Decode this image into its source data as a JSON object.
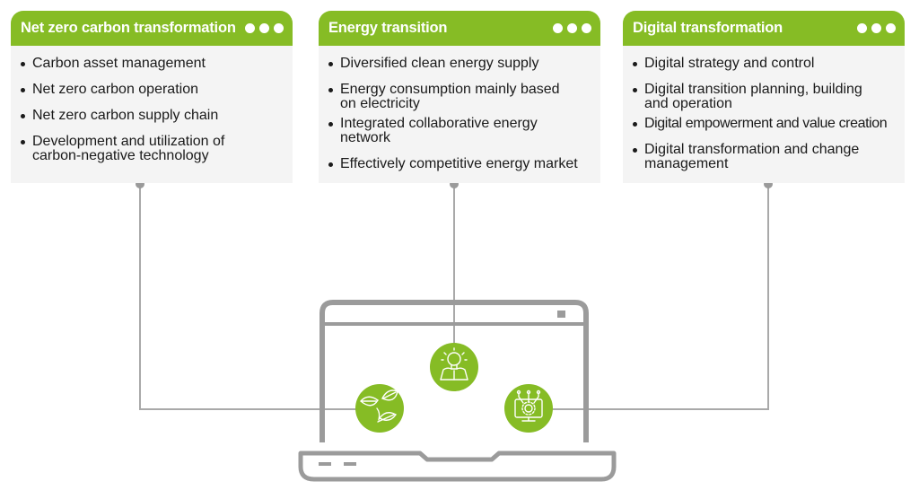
{
  "cards": [
    {
      "title": "Net zero carbon transformation",
      "items": [
        "Carbon asset management",
        "Net zero carbon operation",
        "Net zero carbon supply chain",
        "Development and utilization of carbon-negative technology"
      ],
      "icon": "leaves-icon"
    },
    {
      "title": "Energy transition",
      "items": [
        "Diversified clean energy supply",
        "Energy consumption mainly based on electricity",
        "Integrated collaborative energy network",
        "Effectively competitive energy market"
      ],
      "icon": "lightbulb-person-icon"
    },
    {
      "title": "Digital transformation",
      "items": [
        "Digital strategy and control",
        "Digital transition planning, building and operation",
        "Digital empowerment and value creation",
        "Digital transformation and change management"
      ],
      "icon": "digital-monitor-gear-icon"
    }
  ],
  "colors": {
    "accent": "#86bc25",
    "card_bg": "#f4f4f4",
    "line": "#a7a7a7",
    "laptop": "#9b9b9b"
  }
}
